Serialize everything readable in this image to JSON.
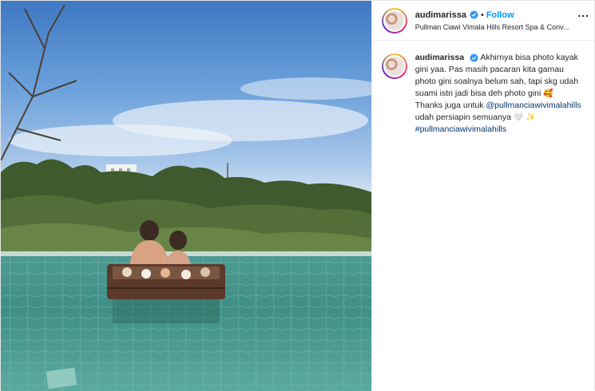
{
  "post": {
    "username": "audimarissa",
    "follow_label": "Follow",
    "separator": "•",
    "location": "Pullman Ciawi Vimala Hills Resort Spa & Conv...",
    "more_label": "...",
    "caption": {
      "username": "audimarissa",
      "text_part1": "Akhirnya bisa photo kayak gini yaa. Pas masih pacaran kita gamau photo gini soalnya belum sah, tapi skg udah suami istri jadi bisa deh photo gini",
      "emoji1": "🥰",
      "text_part2": "Thanks juga untuk",
      "mention": "@pullmanciawivimalahills",
      "text_part3": "udah persiapin semuanya",
      "emoji2": "🤍",
      "emoji3": "✨",
      "hashtag": "#pullmanciawivimalahills"
    }
  },
  "colors": {
    "follow_blue": "#0095f6",
    "link_blue": "#00376b",
    "verified_blue": "#3897f0",
    "text": "#262626"
  },
  "icons": {
    "verified": "verified-badge-icon",
    "more": "more-options-icon"
  }
}
